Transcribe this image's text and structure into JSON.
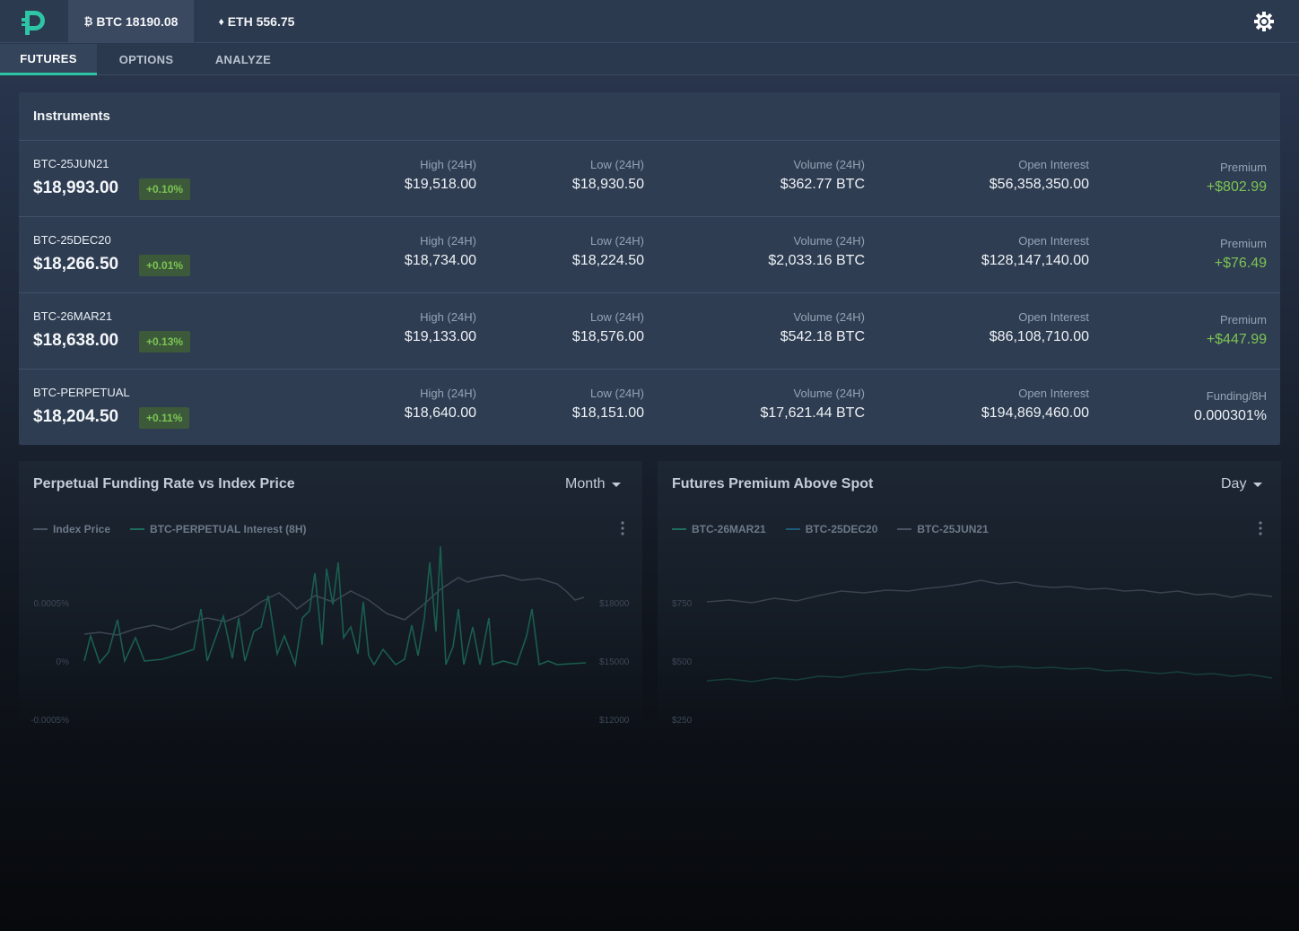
{
  "header": {
    "tickers": [
      {
        "symbol_icon": "bitcoin-icon",
        "label": "BTC 18190.08"
      },
      {
        "symbol_icon": "ethereum-icon",
        "label": "ETH 556.75"
      }
    ],
    "settings_icon": "gear-icon",
    "accent": "#2ec4a6"
  },
  "tabs": [
    {
      "label": "FUTURES",
      "active": true
    },
    {
      "label": "OPTIONS",
      "active": false
    },
    {
      "label": "ANALYZE",
      "active": false
    }
  ],
  "instruments": {
    "title": "Instruments",
    "rows": [
      {
        "name": "BTC-25JUN21",
        "price": "$18,993.00",
        "change": "+0.10%",
        "high_label": "High (24H)",
        "high": "$19,518.00",
        "low_label": "Low (24H)",
        "low": "$18,930.50",
        "volume_label": "Volume (24H)",
        "volume": "$362.77 BTC",
        "oi_label": "Open Interest",
        "oi": "$56,358,350.00",
        "last_label": "Premium",
        "last": "+$802.99",
        "last_positive": true
      },
      {
        "name": "BTC-25DEC20",
        "price": "$18,266.50",
        "change": "+0.01%",
        "high_label": "High (24H)",
        "high": "$18,734.00",
        "low_label": "Low (24H)",
        "low": "$18,224.50",
        "volume_label": "Volume (24H)",
        "volume": "$2,033.16 BTC",
        "oi_label": "Open Interest",
        "oi": "$128,147,140.00",
        "last_label": "Premium",
        "last": "+$76.49",
        "last_positive": true
      },
      {
        "name": "BTC-26MAR21",
        "price": "$18,638.00",
        "change": "+0.13%",
        "high_label": "High (24H)",
        "high": "$19,133.00",
        "low_label": "Low (24H)",
        "low": "$18,576.00",
        "volume_label": "Volume (24H)",
        "volume": "$542.18 BTC",
        "oi_label": "Open Interest",
        "oi": "$86,108,710.00",
        "last_label": "Premium",
        "last": "+$447.99",
        "last_positive": true
      },
      {
        "name": "BTC-PERPETUAL",
        "price": "$18,204.50",
        "change": "+0.11%",
        "high_label": "High (24H)",
        "high": "$18,640.00",
        "low_label": "Low (24H)",
        "low": "$18,151.00",
        "volume_label": "Volume (24H)",
        "volume": "$17,621.44 BTC",
        "oi_label": "Open Interest",
        "oi": "$194,869,460.00",
        "last_label": "Funding/8H",
        "last": "0.000301%",
        "last_positive": false
      }
    ]
  },
  "charts": [
    {
      "title": "Perpetual Funding Rate vs Index Price",
      "range": "Month",
      "legend": [
        {
          "name": "Index Price",
          "color": "#4b5563"
        },
        {
          "name": "BTC-PERPETUAL Interest (8H)",
          "color": "#1f6e5c"
        }
      ],
      "left_ticks": [
        "0.0005%",
        "0%",
        "-0.0005%"
      ],
      "right_ticks": [
        "$18000",
        "$15000",
        "$12000"
      ]
    },
    {
      "title": "Futures Premium Above Spot",
      "range": "Day",
      "legend": [
        {
          "name": "BTC-26MAR21",
          "color": "#1f6e5c"
        },
        {
          "name": "BTC-25DEC20",
          "color": "#1d5a78"
        },
        {
          "name": "BTC-25JUN21",
          "color": "#4b5563"
        }
      ],
      "left_ticks": [
        "$750",
        "$500",
        "$250"
      ]
    }
  ]
}
